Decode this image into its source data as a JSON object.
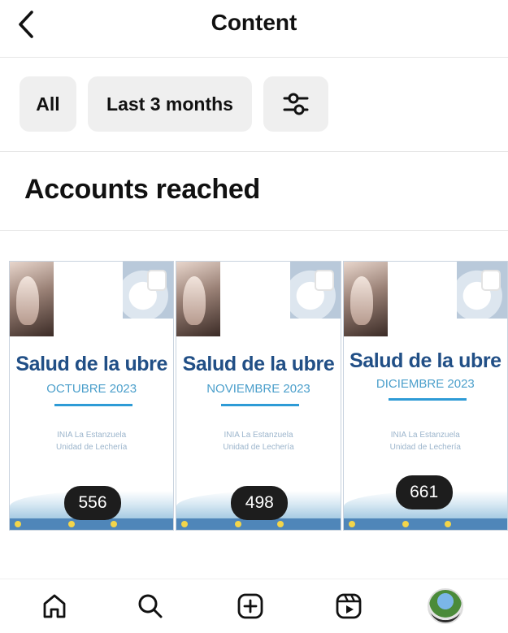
{
  "header": {
    "title": "Content"
  },
  "filters": {
    "all_label": "All",
    "range_label": "Last 3 months"
  },
  "section": {
    "title": "Accounts reached"
  },
  "posts": [
    {
      "title": "Salud de la ubre",
      "month": "OCTUBRE 2023",
      "org_line1": "INIA La Estanzuela",
      "org_line2": "Unidad de Lechería",
      "count": "556"
    },
    {
      "title": "Salud de la ubre",
      "month": "NOVIEMBRE 2023",
      "org_line1": "INIA La Estanzuela",
      "org_line2": "Unidad de Lechería",
      "count": "498"
    },
    {
      "title": "Salud de la ubre",
      "month": "DICIEMBRE 2023",
      "org_line1": "INIA La Estanzuela",
      "org_line2": "Unidad de Lechería",
      "count": "661"
    }
  ],
  "tabbar": {
    "icons": [
      "home-icon",
      "search-icon",
      "create-icon",
      "reels-icon",
      "profile-avatar"
    ]
  }
}
